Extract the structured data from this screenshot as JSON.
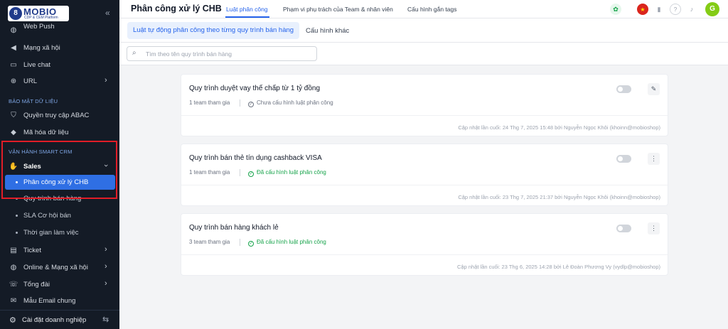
{
  "sidebar": {
    "logo_text": "MOBIO",
    "logo_sub": "CDP & CEM Platform",
    "collapse_icon": "«",
    "items_top": [
      {
        "label": "Web Push",
        "icon": "globe-icon"
      },
      {
        "label": "Mạng xã hội",
        "icon": "megaphone-icon"
      },
      {
        "label": "Live chat",
        "icon": "chat-icon"
      },
      {
        "label": "URL",
        "icon": "link-icon"
      }
    ],
    "section_security": "BẢO MẬT DỮ LIỆU",
    "items_security": [
      {
        "label": "Quyền truy cập ABAC",
        "icon": "shield-icon"
      },
      {
        "label": "Mã hóa dữ liệu",
        "icon": "layers-icon"
      }
    ],
    "section_crm": "VẬN HÀNH SMART CRM",
    "sales_label": "Sales",
    "sales_subitems": [
      {
        "label": "Phân công xử lý CHB",
        "active": true
      },
      {
        "label": "Quy trình bán hàng"
      },
      {
        "label": "SLA Cơ hội bán"
      },
      {
        "label": "Thời gian làm việc"
      }
    ],
    "items_bottom": [
      {
        "label": "Ticket",
        "icon": "ticket-icon"
      },
      {
        "label": "Online & Mạng xã hội",
        "icon": "globe-icon"
      },
      {
        "label": "Tổng đài",
        "icon": "phone-icon"
      },
      {
        "label": "Mẫu Email chung",
        "icon": "mail-icon"
      }
    ],
    "footer_label": "Cài đặt doanh nghiệp"
  },
  "header": {
    "title": "Phân công xử lý CHB",
    "tabs": [
      {
        "label": "Luật phân công",
        "active": true
      },
      {
        "label": "Phạm vi phụ trách của Team & nhân viên"
      },
      {
        "label": "Cấu hình gắn tags"
      }
    ],
    "avatar_initial": "G"
  },
  "subtabs": {
    "active": "Luật tự động phân công theo từng quy trình bán hàng",
    "other": "Cấu hình khác"
  },
  "search": {
    "placeholder": "Tìm theo tên quy trình bán hàng",
    "value": ""
  },
  "cards": [
    {
      "title": "Quy trình duyệt vay thế chấp từ 1 tỷ đồng",
      "teams": "1 team tham gia",
      "status": "Chưa cấu hình luật phân công",
      "configured": false,
      "enabled": false,
      "action_icon": "edit-icon",
      "updated": "Cập nhật lần cuối: 24 Thg 7, 2025 15:48 bởi Nguyễn Ngọc Khôi (khoinn@mobioshop)"
    },
    {
      "title": "Quy trình bán thẻ tín dụng cashback VISA",
      "teams": "1 team tham gia",
      "status": "Đã cấu hình luật phân công",
      "configured": true,
      "enabled": false,
      "action_icon": "more-icon",
      "updated": "Cập nhật lần cuối: 23 Thg 7, 2025 21:37 bởi Nguyễn Ngọc Khôi (khoinn@mobioshop)"
    },
    {
      "title": "Quy trình bán hàng khách lẻ",
      "teams": "3 team tham gia",
      "status": "Đã cấu hình luật phân công",
      "configured": true,
      "enabled": false,
      "action_icon": "more-icon",
      "updated": "Cập nhật lần cuối: 23 Thg 6, 2025 14:28 bởi Lê Đoàn Phương Vy (vydlp@mobioshop)"
    }
  ],
  "colors": {
    "sidebar_bg": "#141b26",
    "accent": "#2563eb",
    "active_item": "#2f6fe4",
    "highlight_border": "#e11d27",
    "success": "#16a34a"
  }
}
